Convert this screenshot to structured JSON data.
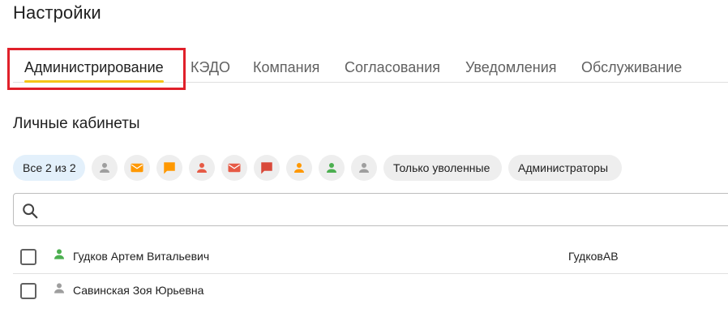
{
  "header": {
    "title": "Настройки"
  },
  "tabs": [
    {
      "label": "Администрирование",
      "active": true
    },
    {
      "label": "КЭДО"
    },
    {
      "label": "Компания"
    },
    {
      "label": "Согласования"
    },
    {
      "label": "Уведомления"
    },
    {
      "label": "Обслуживание"
    }
  ],
  "section": {
    "title": "Личные кабинеты"
  },
  "filters": {
    "all_label": "Все 2 из 2",
    "icons": [
      {
        "name": "person-gray-icon",
        "color": "#9e9e9e"
      },
      {
        "name": "mail-orange-icon",
        "color": "#ff9800"
      },
      {
        "name": "chat-orange-icon",
        "color": "#ff9800"
      },
      {
        "name": "person-red-icon",
        "color": "#e65a45"
      },
      {
        "name": "mail-red-icon",
        "color": "#e65a45"
      },
      {
        "name": "chat-red-icon",
        "color": "#e65a45"
      },
      {
        "name": "person-orange-icon",
        "color": "#ff9800"
      },
      {
        "name": "person-green-icon",
        "color": "#4caf50"
      },
      {
        "name": "person-gray-icon",
        "color": "#9e9e9e"
      }
    ],
    "fired_label": "Только уволенные",
    "admins_label": "Администраторы"
  },
  "search": {
    "placeholder": "",
    "value": ""
  },
  "users": [
    {
      "name": "Гудков Артем Витальевич",
      "login": "ГудковАВ",
      "status_color": "#4caf50"
    },
    {
      "name": "Савинская Зоя Юрьевна",
      "login": "",
      "status_color": "#9e9e9e"
    }
  ],
  "colors": {
    "accent": "#f5c518",
    "highlight": "#e0202a",
    "selected_chip": "#e3f0fb"
  }
}
